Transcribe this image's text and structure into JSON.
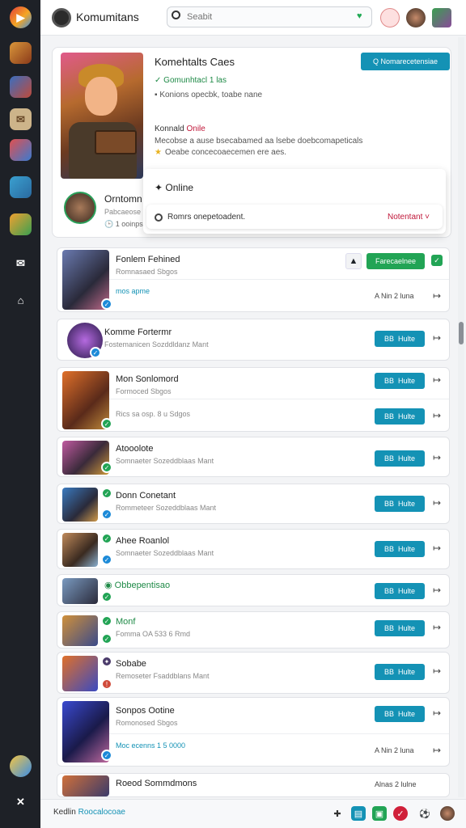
{
  "app": {
    "title": "Komumitans"
  },
  "search": {
    "placeholder": "Seabit"
  },
  "hero": {
    "title": "Komehtalts Caes",
    "cta": "Q Nomarecetensiae",
    "check": "Gomunhtacl 1 las",
    "note": "Konions opecbk, toabe nane",
    "section_prefix": "Konnald",
    "section_status": "Onile",
    "desc1": "Mecobse a ause bsecabamed aa lsebe doebcomapeticals",
    "desc2": "Oeabe concecoaecemen ere aes.",
    "sub_name": "Orntomn",
    "sub_meta1": "Pabcaeose",
    "sub_meta2": "1 ooinps"
  },
  "popup": {
    "online": "Online",
    "row_text": "Romrs onepetoadent.",
    "row_note": "Notentant"
  },
  "cards": [
    {
      "name": "Fonlem Fehined",
      "meta": "Romnasaed Sbgos",
      "extra": "mos apme",
      "side": "A Nin 2 luna",
      "button": "Farecaelnee"
    },
    {
      "name": "Komme Fortermr",
      "meta": "Fostemanicen Sozddldanz Mant",
      "button": "Hulte",
      "button_code": "BB"
    },
    {
      "name": "Mon Sonlomord",
      "meta": "Formoced Sbgos",
      "extra": "Rics sa osp. 8 u Sdgos",
      "button": "Hulte",
      "button2": "Hulte",
      "button_code": "BB"
    },
    {
      "name": "Atooolote",
      "meta": "Somnaeter Sozeddblaas Mant",
      "button": "Hulte",
      "button_code": "BB"
    },
    {
      "name": "Donn Conetant",
      "meta": "Rommeteer Sozeddblaas Mant",
      "button": "Hulte",
      "button_code": "BB"
    },
    {
      "name": "Ahee Roanlol",
      "meta": "Somnaeter Sozeddblaas Mant",
      "button": "Hulte",
      "button_code": "BB"
    },
    {
      "name": "Obbepentisao",
      "button": "Hulte",
      "button_code": "BB"
    },
    {
      "name": "Monf",
      "meta": "Fomma OA 533 6 Rmd",
      "button": "Hulte",
      "button_code": "BB"
    },
    {
      "name": "Sobabe",
      "meta": "Remoseter Fsaddblans Mant",
      "button": "Hulte",
      "button_code": "BB"
    },
    {
      "name": "Sonpos Ootine",
      "meta": "Romonosed Sbgos",
      "extra": "Moc ecenns 1 5 0000",
      "side": "A Nin 2 luna",
      "button": "Hulte",
      "button_code": "BB"
    },
    {
      "name": "Roeod Sommdmons",
      "side": "Alnas 2 lulne"
    }
  ],
  "footer": {
    "label": "Kedlin",
    "link": "Roocalocoae"
  }
}
